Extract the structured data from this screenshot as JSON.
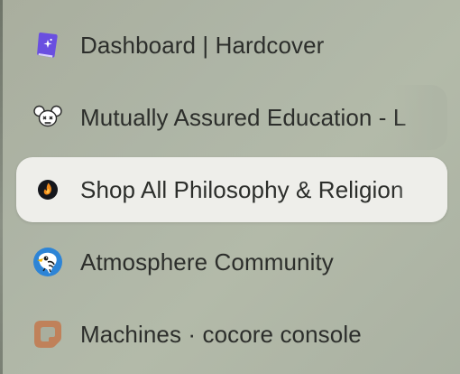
{
  "tabs": [
    {
      "label": "Dashboard | Hardcover",
      "icon": "hardcover-book-icon",
      "selected": false
    },
    {
      "label": "Mutually Assured Education - L",
      "icon": "mouse-skull-icon",
      "selected": false
    },
    {
      "label": "Shop All Philosophy & Religion",
      "icon": "flame-logo-icon",
      "selected": true
    },
    {
      "label": "Atmosphere Community",
      "icon": "bird-logo-icon",
      "selected": false
    },
    {
      "label": "Machines · cocore console",
      "icon": "cocore-logo-icon",
      "selected": false
    }
  ],
  "colors": {
    "selected_background": "#eeeeea",
    "text": "#2c2e2b",
    "hardcover_purple": "#6a4fe0",
    "flame_orange": "#f08a1c",
    "bird_blue": "#2d84d6",
    "cocore_brown": "#c0815a"
  }
}
